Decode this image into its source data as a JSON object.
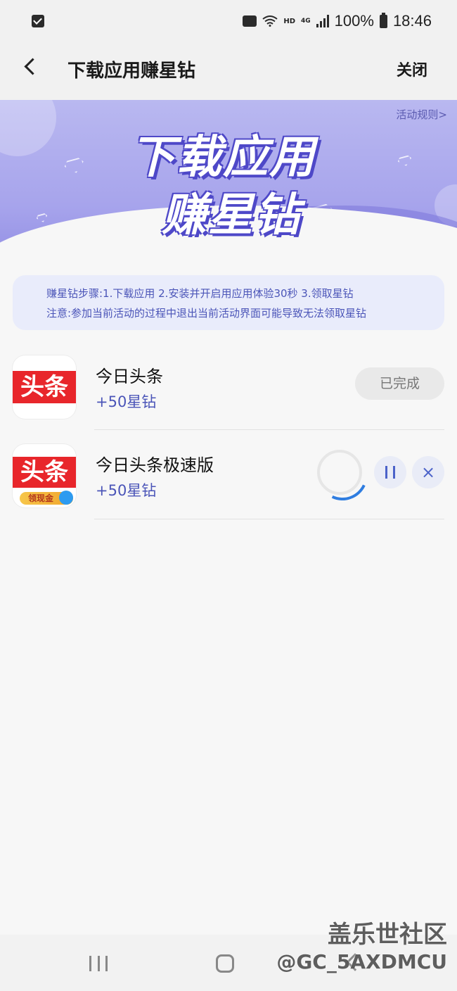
{
  "status_bar": {
    "battery": "100%",
    "time": "18:46",
    "network_hd": "HD",
    "network_type": "4G",
    "icons": [
      "checkbox-icon",
      "message-icon",
      "wifi-icon",
      "signal-icon",
      "battery-icon"
    ]
  },
  "header": {
    "title": "下载应用赚星钻",
    "close_label": "关闭"
  },
  "banner": {
    "title_line1": "下载应用",
    "title_line2": "赚星钻",
    "rules_link": "活动规则>"
  },
  "steps": {
    "line1": "赚星钻步骤:1.下载应用 2.安装并开启用应用体验30秒 3.领取星钻",
    "line2": "注意:参加当前活动的过程中退出当前活动界面可能导致无法领取星钻"
  },
  "apps": [
    {
      "name": "今日头条",
      "reward": "+50星钻",
      "icon_text": "头条",
      "status_label": "已完成"
    },
    {
      "name": "今日头条极速版",
      "reward": "+50星钻",
      "icon_text": "头条",
      "icon_badge": "领现金",
      "status": "downloading"
    }
  ],
  "colors": {
    "accent": "#4b55b8",
    "banner": "#a7a4ec",
    "logo_red": "#e8262b",
    "progress": "#2f7de0"
  },
  "watermark": {
    "line1": "盖乐世社区",
    "line2": "@GC_5AXDMCU"
  }
}
